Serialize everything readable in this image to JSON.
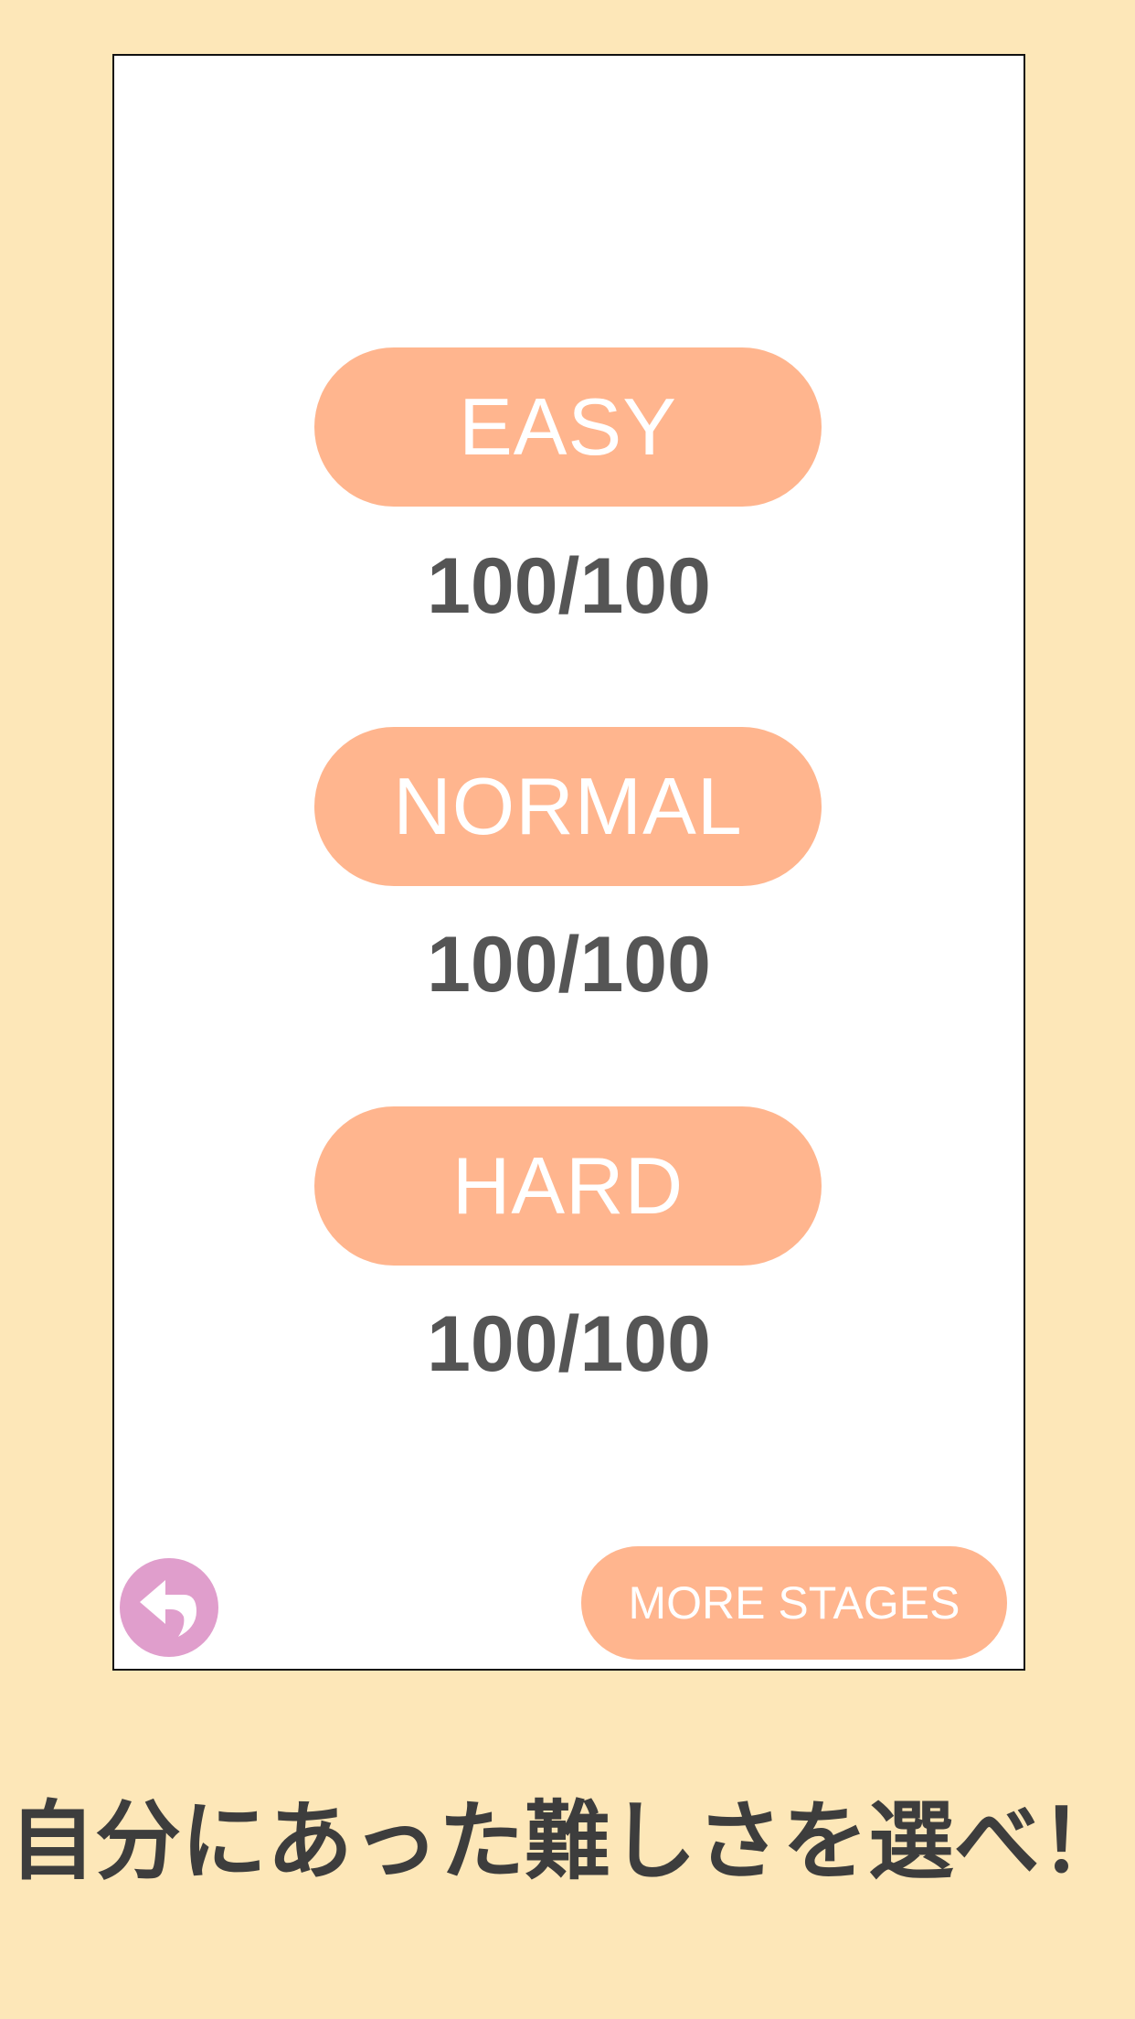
{
  "levels": [
    {
      "label": "EASY",
      "score": "100/100"
    },
    {
      "label": "NORMAL",
      "score": "100/100"
    },
    {
      "label": "HARD",
      "score": "100/100"
    }
  ],
  "footer": {
    "back_icon": "back-arrow-icon",
    "more_label": "MORE STAGES"
  },
  "caption": "自分にあった難しさを選べ！",
  "colors": {
    "background": "#fde7b8",
    "button": "#ffb58e",
    "back_button": "#e09ecc",
    "score_text": "#555555",
    "caption_text": "#3d3d3d"
  }
}
